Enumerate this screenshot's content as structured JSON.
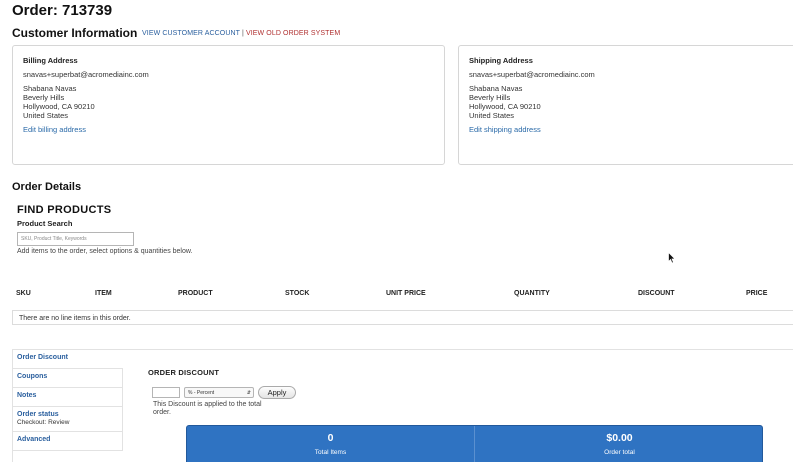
{
  "order": {
    "title": "Order: 713739"
  },
  "customer": {
    "heading": "Customer Information",
    "view_account_link": "VIEW CUSTOMER ACCOUNT",
    "separator": "|",
    "view_old_system_link": "VIEW OLD ORDER SYSTEM"
  },
  "billing": {
    "title": "Billing Address",
    "email": "snavas+superbat@acromediainc.com",
    "name": "Shabana Navas",
    "line1": "Beverly Hills",
    "line2": "Hollywood, CA 90210",
    "country": "United States",
    "edit_link": "Edit billing address"
  },
  "shipping": {
    "title": "Shipping Address",
    "email": "snavas+superbat@acromediainc.com",
    "name": "Shabana Navas",
    "line1": "Beverly Hills",
    "line2": "Hollywood, CA 90210",
    "country": "United States",
    "edit_link": "Edit shipping address"
  },
  "details": {
    "heading": "Order Details",
    "find_products": "FIND PRODUCTS",
    "search_label": "Product Search",
    "search_placeholder": "SKU, Product Title, Keywords",
    "add_note": "Add items to the order, select options & quantities below."
  },
  "table": {
    "columns": {
      "sku": "SKU",
      "item": "ITEM",
      "product": "PRODUCT",
      "stock": "STOCK",
      "unit_price": "UNIT PRICE",
      "quantity": "QUANTITY",
      "discount": "DISCOUNT",
      "price": "PRICE"
    },
    "empty_message": "There are no line items in this order."
  },
  "sidebar": {
    "order_discount": "Order Discount",
    "coupons": "Coupons",
    "notes": "Notes",
    "order_status": "Order status",
    "order_status_sub": "Checkout: Review",
    "advanced": "Advanced"
  },
  "discount": {
    "heading": "ORDER DISCOUNT",
    "type_value": "% - Percent",
    "apply_label": "Apply",
    "note": "This Discount is applied to the total order."
  },
  "totals": {
    "items_value": "0",
    "items_label": "Total Items",
    "order_value": "$0.00",
    "order_label": "Order total"
  },
  "colors": {
    "link_blue": "#2a5f9e",
    "link_red": "#b03030",
    "totals_blue": "#2f73c2"
  }
}
